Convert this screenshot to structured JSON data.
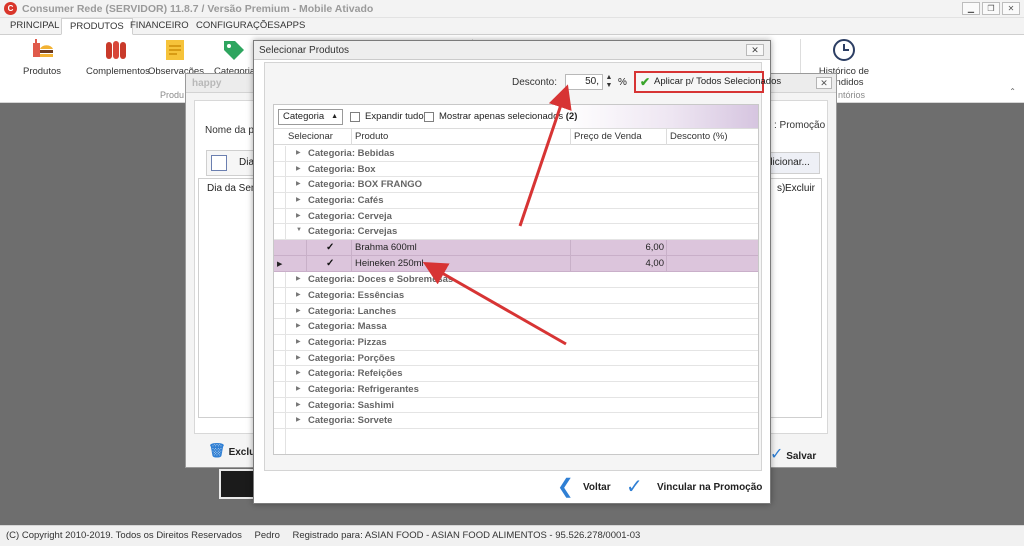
{
  "app": {
    "logo": "C",
    "title": "Consumer Rede (SERVIDOR) 11.8.7 / Versão Premium - Mobile Ativado",
    "window_buttons": [
      "▁",
      "❐",
      "✕"
    ]
  },
  "ribbon_tabs": [
    "PRINCIPAL",
    "PRODUTOS",
    "FINANCEIRO",
    "CONFIGURAÇÕES",
    "APPS"
  ],
  "ribbon": {
    "items": [
      "Produtos",
      "Complementos",
      "Observações",
      "Categoria"
    ],
    "group_label": "Produ",
    "right_item_line1": "Histórico de",
    "right_item_line2": "Vendidos",
    "right_group_label": "ntórios"
  },
  "bg_window": {
    "title": "happy",
    "close": "✕",
    "name_label": "Nome da pron",
    "promo_label": ": Promoção",
    "days_button": "Dias",
    "col_day": "Dia da Sema",
    "col_s": "s)",
    "col_delete": "Excluir",
    "add_button": "dicionar...",
    "delete_button": "Exclu",
    "save_button": "Salvar"
  },
  "dialog": {
    "title": "Selecionar Produtos",
    "close": "✕",
    "discount_label": "Desconto:",
    "discount_value": "50,",
    "percent": "%",
    "apply_button": "Aplicar p/ Todos Selecionados",
    "group_by": "Categoria",
    "expand_all": "Expandir tudo",
    "show_selected": "Mostrar apenas selecionados",
    "selected_count": "(2)",
    "columns": [
      "Selecionar",
      "Produto",
      "Preço de Venda",
      "Desconto (%)"
    ],
    "categories_before": [
      "Categoria: Bebidas",
      "Categoria: Box",
      "Categoria: BOX FRANGO",
      "Categoria: Cafés",
      "Categoria: Cerveja"
    ],
    "expanded_category": "Categoria: Cervejas",
    "products": [
      {
        "name": "Brahma 600ml",
        "price": "6,00",
        "checked": "✓"
      },
      {
        "name": "Heineken 250ml",
        "price": "4,00",
        "checked": "✓"
      }
    ],
    "categories_after": [
      "Categoria: Doces e Sobremesas",
      "Categoria: Essências",
      "Categoria: Lanches",
      "Categoria: Massa",
      "Categoria: Pizzas",
      "Categoria: Porções",
      "Categoria: Refeições",
      "Categoria: Refrigerantes",
      "Categoria: Sashimi",
      "Categoria: Sorvete"
    ],
    "back_button": "Voltar",
    "link_button": "Vincular na Promoção"
  },
  "status": {
    "copyright": "(C) Copyright 2010-2019. Todos os Direitos Reservados",
    "user": "Pedro",
    "registered": "Registrado para: ASIAN FOOD - ASIAN FOOD ALIMENTOS - 95.526.278/0001-03"
  },
  "colors": {
    "selected_row": "#dcc5dc",
    "highlight": "#d73434",
    "accent_blue": "#2f7fd4"
  }
}
